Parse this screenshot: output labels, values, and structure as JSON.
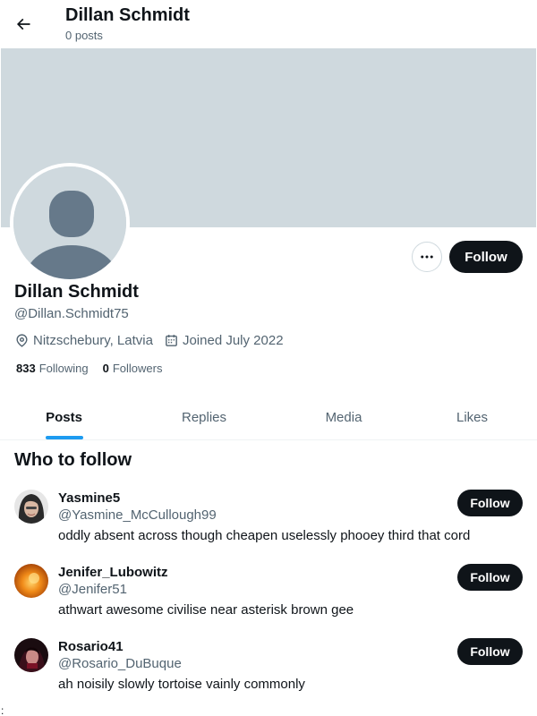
{
  "header": {
    "title": "Dillan Schmidt",
    "subtitle": "0 posts",
    "back_icon": "arrow-left-icon"
  },
  "colors": {
    "banner": "#cfd9de",
    "text": "#0f1419",
    "muted": "#536471",
    "accent": "#1d9bf0",
    "button": "#0f1419"
  },
  "profile": {
    "name": "Dillan Schmidt",
    "handle": "@Dillan.Schmidt75",
    "location": "Nitzschebury, Latvia",
    "joined": "Joined July 2022",
    "following_count": "833",
    "following_label": "Following",
    "followers_count": "0",
    "followers_label": "Followers",
    "follow_label": "Follow",
    "more_icon": "more-horizontal-icon"
  },
  "tabs": [
    {
      "label": "Posts",
      "active": true
    },
    {
      "label": "Replies",
      "active": false
    },
    {
      "label": "Media",
      "active": false
    },
    {
      "label": "Likes",
      "active": false
    }
  ],
  "who_to_follow": {
    "title": "Who to follow",
    "items": [
      {
        "name": "Yasmine5",
        "handle": "@Yasmine_McCullough99",
        "bio": "oddly absent across though cheapen uselessly phooey third that cord",
        "follow_label": "Follow"
      },
      {
        "name": "Jenifer_Lubowitz",
        "handle": "@Jenifer51",
        "bio": "athwart awesome civilise near asterisk brown gee",
        "follow_label": "Follow"
      },
      {
        "name": "Rosario41",
        "handle": "@Rosario_DuBuque",
        "bio": "ah noisily slowly tortoise vainly commonly",
        "follow_label": "Follow"
      }
    ]
  },
  "edge_char": ":"
}
